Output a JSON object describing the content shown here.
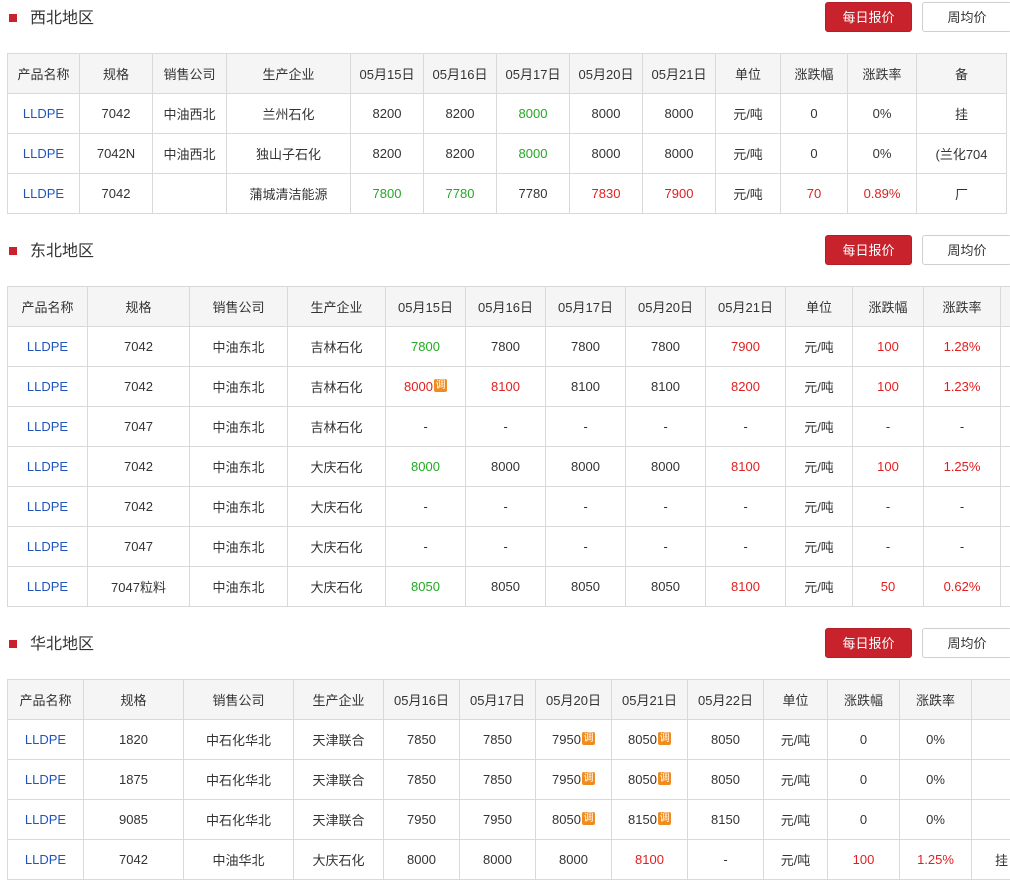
{
  "buttons": {
    "daily": "每日报价",
    "weekly": "周均价"
  },
  "sections": [
    {
      "title": "西北地区",
      "headers": [
        "产品名称",
        "规格",
        "销售公司",
        "生产企业",
        "05月15日",
        "05月16日",
        "05月17日",
        "05月20日",
        "05月21日",
        "单位",
        "涨跌幅",
        "涨跌率",
        "备"
      ],
      "rows": [
        {
          "cells": [
            "LLDPE",
            "7042",
            "中油西北",
            "兰州石化",
            "8200",
            "8200",
            "8000",
            "8000",
            "8000",
            "元/吨",
            "0",
            "0%",
            "挂"
          ],
          "colors": [
            "",
            "",
            "",
            "",
            "",
            "",
            "green",
            "",
            "",
            "",
            "",
            "",
            ""
          ],
          "adj": []
        },
        {
          "cells": [
            "LLDPE",
            "7042N",
            "中油西北",
            "独山子石化",
            "8200",
            "8200",
            "8000",
            "8000",
            "8000",
            "元/吨",
            "0",
            "0%",
            "(兰化704"
          ],
          "colors": [
            "",
            "",
            "",
            "",
            "",
            "",
            "green",
            "",
            "",
            "",
            "",
            "",
            ""
          ],
          "adj": []
        },
        {
          "cells": [
            "LLDPE",
            "7042",
            "",
            "蒲城清洁能源",
            "7800",
            "7780",
            "7780",
            "7830",
            "7900",
            "元/吨",
            "70",
            "0.89%",
            "厂"
          ],
          "colors": [
            "",
            "",
            "",
            "",
            "green",
            "green",
            "",
            "red",
            "red",
            "",
            "red",
            "red",
            ""
          ],
          "adj": []
        }
      ]
    },
    {
      "title": "东北地区",
      "headers": [
        "产品名称",
        "规格",
        "销售公司",
        "生产企业",
        "05月15日",
        "05月16日",
        "05月17日",
        "05月20日",
        "05月21日",
        "单位",
        "涨跌幅",
        "涨跌率",
        ""
      ],
      "rows": [
        {
          "cells": [
            "LLDPE",
            "7042",
            "中油东北",
            "吉林石化",
            "7800",
            "7800",
            "7800",
            "7800",
            "7900",
            "元/吨",
            "100",
            "1.28%",
            ""
          ],
          "colors": [
            "",
            "",
            "",
            "",
            "green",
            "",
            "",
            "",
            "red",
            "",
            "red",
            "red",
            ""
          ],
          "adj": []
        },
        {
          "cells": [
            "LLDPE",
            "7042",
            "中油东北",
            "吉林石化",
            "8000",
            "8100",
            "8100",
            "8100",
            "8200",
            "元/吨",
            "100",
            "1.23%",
            ""
          ],
          "colors": [
            "",
            "",
            "",
            "",
            "red",
            "red",
            "",
            "",
            "red",
            "",
            "red",
            "red",
            ""
          ],
          "adj": [
            4
          ]
        },
        {
          "cells": [
            "LLDPE",
            "7047",
            "中油东北",
            "吉林石化",
            "-",
            "-",
            "-",
            "-",
            "-",
            "元/吨",
            "-",
            "-",
            ""
          ],
          "colors": [
            "",
            "",
            "",
            "",
            "",
            "",
            "",
            "",
            "",
            "",
            "",
            "",
            ""
          ],
          "adj": []
        },
        {
          "cells": [
            "LLDPE",
            "7042",
            "中油东北",
            "大庆石化",
            "8000",
            "8000",
            "8000",
            "8000",
            "8100",
            "元/吨",
            "100",
            "1.25%",
            ""
          ],
          "colors": [
            "",
            "",
            "",
            "",
            "green",
            "",
            "",
            "",
            "red",
            "",
            "red",
            "red",
            ""
          ],
          "adj": []
        },
        {
          "cells": [
            "LLDPE",
            "7042",
            "中油东北",
            "大庆石化",
            "-",
            "-",
            "-",
            "-",
            "-",
            "元/吨",
            "-",
            "-",
            ""
          ],
          "colors": [
            "",
            "",
            "",
            "",
            "",
            "",
            "",
            "",
            "",
            "",
            "",
            "",
            ""
          ],
          "adj": []
        },
        {
          "cells": [
            "LLDPE",
            "7047",
            "中油东北",
            "大庆石化",
            "-",
            "-",
            "-",
            "-",
            "-",
            "元/吨",
            "-",
            "-",
            ""
          ],
          "colors": [
            "",
            "",
            "",
            "",
            "",
            "",
            "",
            "",
            "",
            "",
            "",
            "",
            ""
          ],
          "adj": []
        },
        {
          "cells": [
            "LLDPE",
            "7047粒料",
            "中油东北",
            "大庆石化",
            "8050",
            "8050",
            "8050",
            "8050",
            "8100",
            "元/吨",
            "50",
            "0.62%",
            ""
          ],
          "colors": [
            "",
            "",
            "",
            "",
            "green",
            "",
            "",
            "",
            "red",
            "",
            "red",
            "red",
            ""
          ],
          "adj": []
        }
      ]
    },
    {
      "title": "华北地区",
      "headers": [
        "产品名称",
        "规格",
        "销售公司",
        "生产企业",
        "05月16日",
        "05月17日",
        "05月20日",
        "05月21日",
        "05月22日",
        "单位",
        "涨跌幅",
        "涨跌率",
        ""
      ],
      "rows": [
        {
          "cells": [
            "LLDPE",
            "1820",
            "中石化华北",
            "天津联合",
            "7850",
            "7850",
            "7950",
            "8050",
            "8050",
            "元/吨",
            "0",
            "0%",
            ""
          ],
          "colors": [
            "",
            "",
            "",
            "",
            "",
            "",
            "",
            "",
            "",
            "",
            "",
            "",
            ""
          ],
          "adj": [
            6,
            7
          ]
        },
        {
          "cells": [
            "LLDPE",
            "1875",
            "中石化华北",
            "天津联合",
            "7850",
            "7850",
            "7950",
            "8050",
            "8050",
            "元/吨",
            "0",
            "0%",
            ""
          ],
          "colors": [
            "",
            "",
            "",
            "",
            "",
            "",
            "",
            "",
            "",
            "",
            "",
            "",
            ""
          ],
          "adj": [
            6,
            7
          ]
        },
        {
          "cells": [
            "LLDPE",
            "9085",
            "中石化华北",
            "天津联合",
            "7950",
            "7950",
            "8050",
            "8150",
            "8150",
            "元/吨",
            "0",
            "0%",
            ""
          ],
          "colors": [
            "",
            "",
            "",
            "",
            "",
            "",
            "",
            "",
            "",
            "",
            "",
            "",
            ""
          ],
          "adj": [
            6,
            7
          ]
        },
        {
          "cells": [
            "LLDPE",
            "7042",
            "中油华北",
            "大庆石化",
            "8000",
            "8000",
            "8000",
            "8100",
            "-",
            "元/吨",
            "100",
            "1.25%",
            "挂"
          ],
          "colors": [
            "",
            "",
            "",
            "",
            "",
            "",
            "",
            "red",
            "",
            "",
            "red",
            "red",
            ""
          ],
          "adj": []
        }
      ]
    }
  ],
  "adj_label": "调",
  "colors": {
    "accent_red": "#c8232c",
    "up_red": "#e02020",
    "down_green": "#22aa22",
    "link_blue": "#2255bb"
  }
}
